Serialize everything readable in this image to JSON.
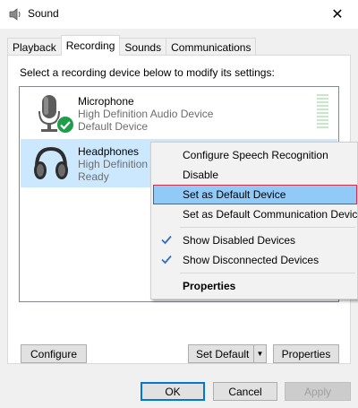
{
  "window": {
    "title": "Sound",
    "close_glyph": "✕"
  },
  "tabs": [
    {
      "label": "Playback"
    },
    {
      "label": "Recording"
    },
    {
      "label": "Sounds"
    },
    {
      "label": "Communications"
    }
  ],
  "panel": {
    "instruction": "Select a recording device below to modify its settings:"
  },
  "devices": [
    {
      "name": "Microphone",
      "driver": "High Definition Audio Device",
      "status": "Default Device",
      "icon": "microphone-icon",
      "default_badge": "green-check"
    },
    {
      "name": "Headphones",
      "driver": "High Definition Audio Device",
      "status": "Ready",
      "icon": "headphones-icon"
    }
  ],
  "buttons": {
    "configure": "Configure",
    "set_default": "Set Default",
    "properties": "Properties",
    "ok": "OK",
    "cancel": "Cancel",
    "apply": "Apply"
  },
  "context_menu": {
    "items": [
      {
        "label": "Configure Speech Recognition"
      },
      {
        "label": "Disable"
      },
      {
        "label": "Set as Default Device",
        "highlighted": true
      },
      {
        "label": "Set as Default Communication Device"
      },
      {
        "label": "Show Disabled Devices",
        "checked": true
      },
      {
        "label": "Show Disconnected Devices",
        "checked": true
      },
      {
        "label": "Properties",
        "bold": true
      }
    ]
  },
  "colors": {
    "selection": "#cce8ff",
    "menu_highlight": "#91c9f7",
    "menu_highlight_border": "#c8344f",
    "accent": "#0078d7",
    "default_badge": "#1e9e4a"
  }
}
